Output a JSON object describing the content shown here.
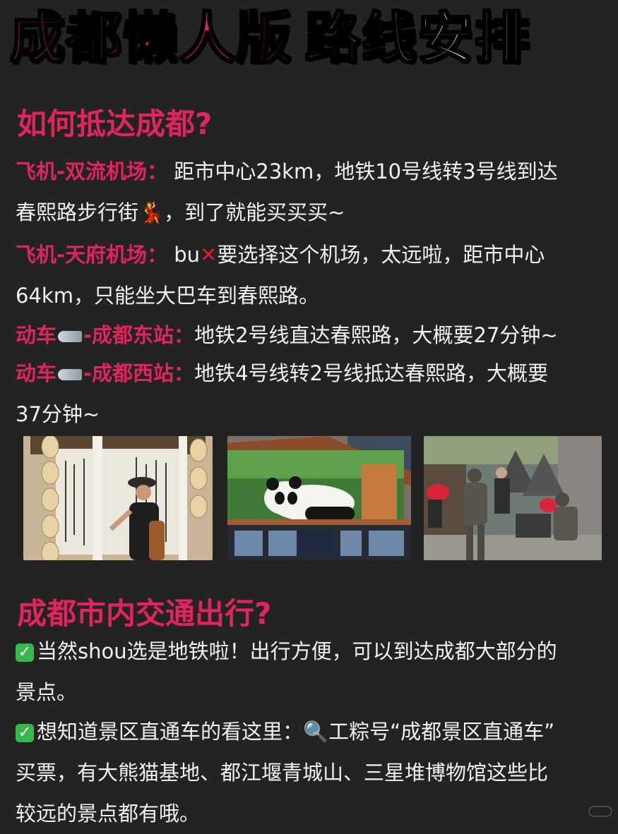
{
  "title": {
    "left": "成都懒人版",
    "right": "路线安排"
  },
  "section1": {
    "heading": "如何抵达成都?",
    "items": [
      {
        "label": "飞机-双流机场：",
        "text1": "距市中心23km，地铁10号线转3号线到达",
        "text2": "春熙路步行街",
        "text3": "，到了就能买买买~"
      },
      {
        "label": "飞机-天府机场：",
        "text1": "bu",
        "text2": "要选择这个机场，太远啦，距市中心",
        "text3": "64km，只能坐大巴车到春熙路。"
      },
      {
        "label_a": "动车",
        "label_b": "-成都东站：",
        "text": "地铁2号线直达春熙路，大概要27分钟~"
      },
      {
        "label_a": "动车",
        "label_b": "-成都西站：",
        "text1": "地铁4号线转2号线抵达春熙路，大概要",
        "text2": "37分钟~"
      }
    ]
  },
  "photos": [
    {
      "name": "calligraphy-photo"
    },
    {
      "name": "panda-billboard-photo"
    },
    {
      "name": "street-performer-photo"
    }
  ],
  "section2": {
    "heading": "成都市内交通出行?",
    "p1_line1": "当然shou选是地铁啦！出行方便，可以到达成都大部分的",
    "p1_line2": "景点。",
    "p2_line1a": "想知道景区直通车的看这里：",
    "p2_line1b": "工粽号“成都景区直通车”",
    "p2_line2": "买票，有大熊猫基地、都江堰青城山、三星堆博物馆这些比",
    "p2_line3": "较远的景点都有哦。"
  },
  "colors": {
    "accent": "#e0245e",
    "background": "#232323",
    "text": "#f2f2f2"
  },
  "icons": [
    "dancer-emoji-icon",
    "red-x-icon",
    "bullet-train-icon",
    "green-check-icon",
    "magnifier-icon"
  ]
}
